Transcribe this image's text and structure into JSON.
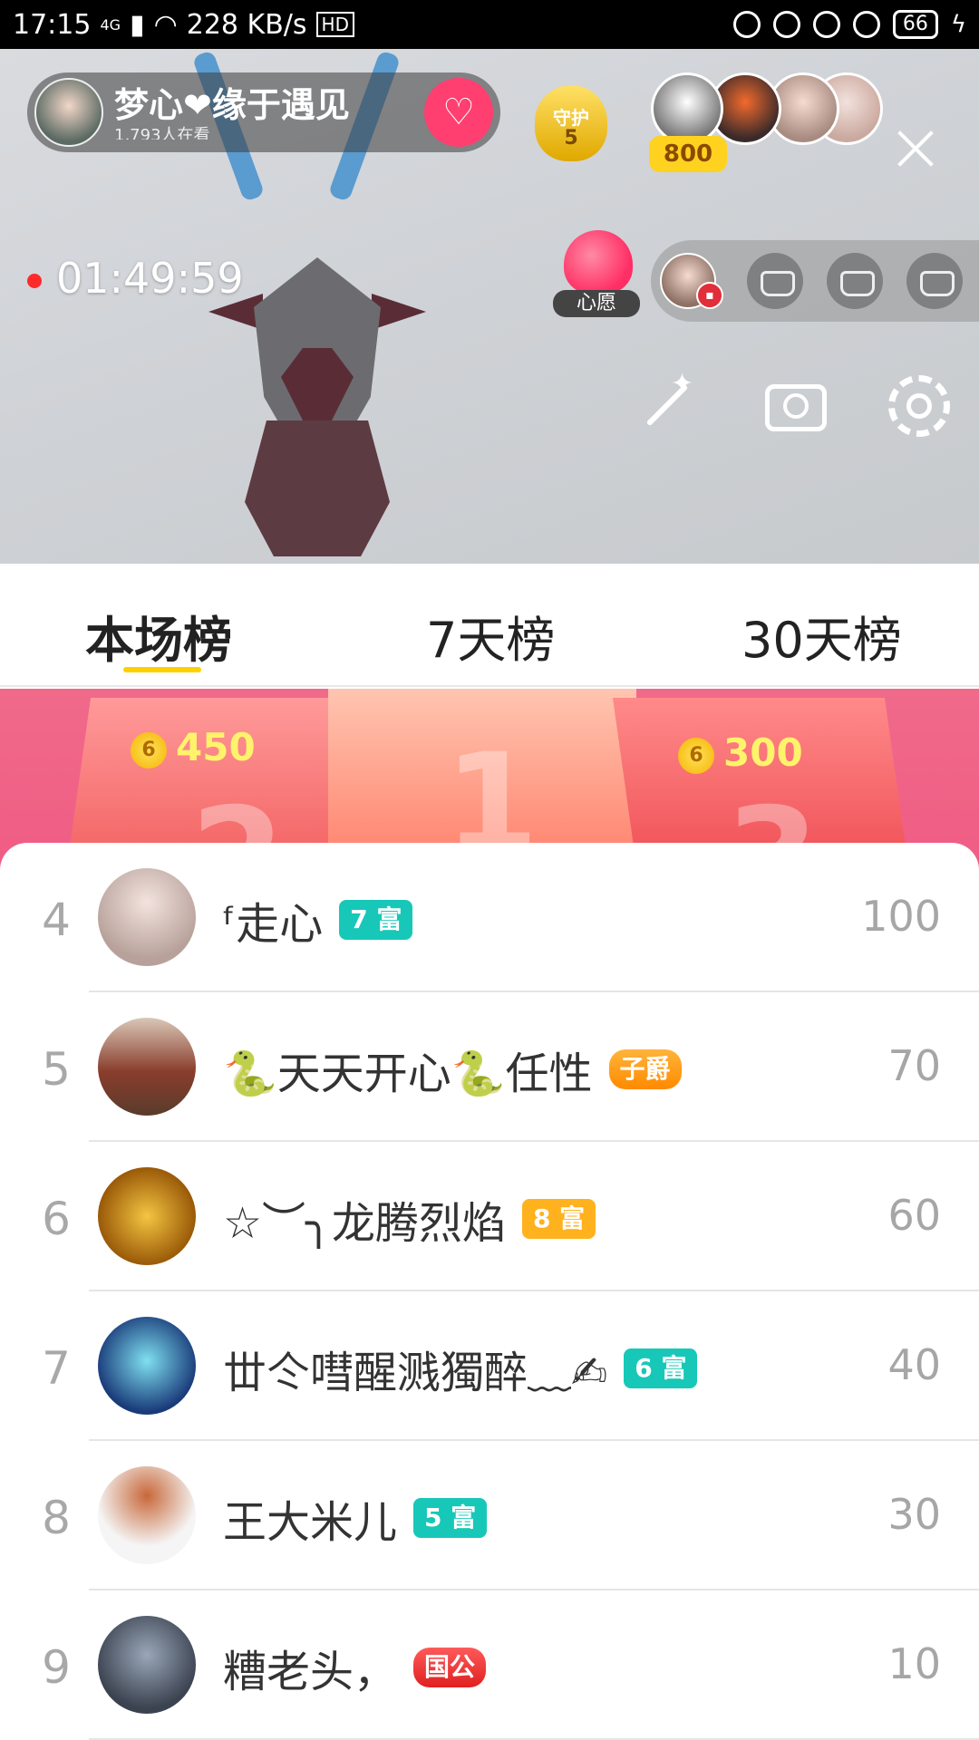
{
  "status_bar": {
    "time": "17:15",
    "network": "4G",
    "speed": "228 KB/s",
    "hd": "HD",
    "battery": "66"
  },
  "live": {
    "anchor_name": "梦心❤缘于遇见",
    "viewers_text": "1,793人在看",
    "follow_icon": "heart-plus-icon",
    "guard_title": "守护",
    "guard_level": "5",
    "audience_count": "800",
    "timer": "01:49:59",
    "wish_label": "心愿"
  },
  "tabs": [
    {
      "label": "本场榜",
      "active": true
    },
    {
      "label": "7天榜",
      "active": false
    },
    {
      "label": "30天榜",
      "active": false
    }
  ],
  "podium": {
    "second_score": "450",
    "third_score": "300",
    "coin_symbol": "6"
  },
  "ranking": [
    {
      "rank": "4",
      "name": "ᶠ走心",
      "badge": "7 富",
      "badge_style": "teal",
      "score": "100"
    },
    {
      "rank": "5",
      "name": "🐍天天开心🐍任性",
      "badge": "子爵",
      "badge_style": "gold",
      "score": "70"
    },
    {
      "rank": "6",
      "name": "☆︶╮龙腾烈焰",
      "badge": "8 富",
      "badge_style": "orange",
      "score": "60"
    },
    {
      "rank": "7",
      "name": "丗仒嘒醒溅獨醉﹏✍",
      "badge": "6 富",
      "badge_style": "teal",
      "score": "40"
    },
    {
      "rank": "8",
      "name": "王大米儿",
      "badge": "5 富",
      "badge_style": "teal",
      "score": "30"
    },
    {
      "rank": "9",
      "name": "糟老头，",
      "badge": "国公",
      "badge_style": "red",
      "score": "10"
    }
  ],
  "colors": {
    "accent_yellow": "#ffd000",
    "podium_pink": "#f06a8a",
    "badge_teal": "#17c8b8"
  }
}
